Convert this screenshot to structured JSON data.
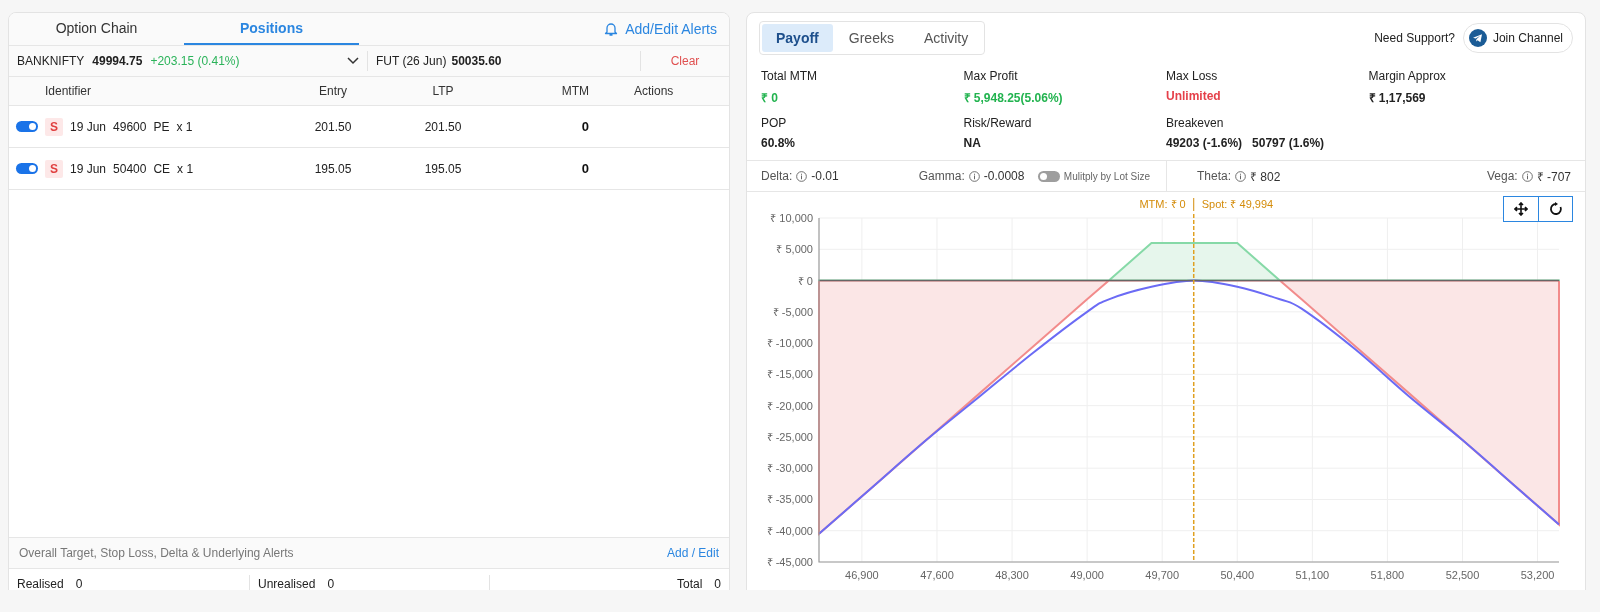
{
  "left_tabs": [
    {
      "label": "Option Chain",
      "selected": false
    },
    {
      "label": "Positions",
      "selected": true
    }
  ],
  "alerts_link": "Add/Edit Alerts",
  "underlying": {
    "symbol": "BANKNIFTY",
    "price": "49994.75",
    "change": "+203.15 (0.41%)",
    "futures_label": "FUT (26 Jun)",
    "futures_price": "50035.60",
    "clear": "Clear"
  },
  "positions": {
    "columns": [
      "Identifier",
      "Entry",
      "LTP",
      "MTM",
      "Actions"
    ],
    "rows": [
      {
        "on": true,
        "side": "S",
        "expiry": "19 Jun",
        "strike": "49600",
        "type": "PE",
        "qty": "x 1",
        "entry": "201.50",
        "ltp": "201.50",
        "mtm": "0"
      },
      {
        "on": true,
        "side": "S",
        "expiry": "19 Jun",
        "strike": "50400",
        "type": "CE",
        "qty": "x 1",
        "entry": "195.05",
        "ltp": "195.05",
        "mtm": "0"
      }
    ]
  },
  "overall_alerts": {
    "label": "Overall Target, Stop Loss, Delta & Underlying Alerts",
    "link": "Add / Edit"
  },
  "totals": [
    {
      "label": "Realised",
      "value": "0"
    },
    {
      "label": "Unrealised",
      "value": "0"
    },
    {
      "label": "Total",
      "value": "0"
    }
  ],
  "right_tabs": [
    {
      "label": "Payoff",
      "selected": true
    },
    {
      "label": "Greeks",
      "selected": false
    },
    {
      "label": "Activity",
      "selected": false
    }
  ],
  "support": {
    "label": "Need Support?",
    "button": "Join Channel"
  },
  "stats": [
    {
      "label": "Total MTM",
      "values": [
        "₹ 0"
      ],
      "color": "#22b34f"
    },
    {
      "label": "Max Profit",
      "values": [
        "₹ 5,948.25(5.06%)"
      ],
      "color": "#22b34f"
    },
    {
      "label": "Max Loss",
      "values": [
        "Unlimited"
      ],
      "color": "#e5404a"
    },
    {
      "label": "Margin Approx",
      "values": [
        "₹ 1,17,569"
      ],
      "color": "#222222"
    },
    {
      "label": "POP",
      "values": [
        "60.8%"
      ],
      "color": "#222222"
    },
    {
      "label": "Risk/Reward",
      "values": [
        "NA"
      ],
      "color": "#222222"
    },
    {
      "label": "Breakeven",
      "values": [
        "49203 (-1.6%)",
        "50797 (1.6%)"
      ],
      "color": "#222222"
    }
  ],
  "greeks": [
    {
      "label": "Delta:",
      "value": "-0.01"
    },
    {
      "label": "Gamma:",
      "value": "-0.0008"
    },
    {
      "label": "Theta:",
      "value": "₹ 802"
    },
    {
      "label": "Vega:",
      "value": "₹ -707"
    }
  ],
  "lot_size_toggle": {
    "label": "Mulitply by Lot Size",
    "on": false
  },
  "chart": {
    "chart_data": {
      "type": "area",
      "grid": true,
      "x": [
        46500,
        47000,
        47500,
        48000,
        48500,
        49000,
        49203,
        49600,
        50000,
        50400,
        50797,
        51000,
        51500,
        52000,
        52500,
        53000,
        53400
      ],
      "series": [
        {
          "type": "area",
          "color": "#f28b8b",
          "values": [
            -40500,
            -33000,
            -25500,
            -18000,
            -10500,
            -3000,
            0,
            6000,
            6000,
            6000,
            0,
            -3000,
            -10500,
            -18000,
            -25500,
            -33000,
            -39000
          ]
        },
        {
          "type": "line",
          "color": "#6b6bf5",
          "values": [
            -40500,
            -33000,
            -25500,
            -18500,
            -11500,
            -5000,
            -3000,
            -1000,
            0,
            -1000,
            -3000,
            -4500,
            -11000,
            -18500,
            -25500,
            -33000,
            -39000
          ]
        }
      ],
      "xlim": [
        46500,
        53400
      ],
      "ylim": [
        -45000,
        10000
      ],
      "xticks": [
        {
          "value": 46900,
          "label": "46,900"
        },
        {
          "value": 47600,
          "label": "47,600"
        },
        {
          "value": 48300,
          "label": "48,300"
        },
        {
          "value": 49000,
          "label": "49,000"
        },
        {
          "value": 49700,
          "label": "49,700"
        },
        {
          "value": 50400,
          "label": "50,400"
        },
        {
          "value": 51100,
          "label": "51,100"
        },
        {
          "value": 51800,
          "label": "51,800"
        },
        {
          "value": 52500,
          "label": "52,500"
        },
        {
          "value": 53200,
          "label": "53,200"
        }
      ],
      "yticks": [
        {
          "value": 10000,
          "label": "₹ 10,000"
        },
        {
          "value": 5000,
          "label": "₹ 5,000"
        },
        {
          "value": 0,
          "label": "₹ 0"
        },
        {
          "value": -5000,
          "label": "₹ -5,000"
        },
        {
          "value": -10000,
          "label": "₹ -10,000"
        },
        {
          "value": -15000,
          "label": "₹ -15,000"
        },
        {
          "value": -20000,
          "label": "₹ -20,000"
        },
        {
          "value": -25000,
          "label": "₹ -25,000"
        },
        {
          "value": -30000,
          "label": "₹ -30,000"
        },
        {
          "value": -35000,
          "label": "₹ -35,000"
        },
        {
          "value": -40000,
          "label": "₹ -40,000"
        },
        {
          "value": -45000,
          "label": "₹ -45,000"
        }
      ],
      "ref_lines": [
        {
          "axis": "x",
          "value": 49994,
          "color": "#e0a020"
        }
      ],
      "annotations": [
        "MTM: ₹ 0",
        "Spot: ₹ 49,994"
      ]
    }
  }
}
